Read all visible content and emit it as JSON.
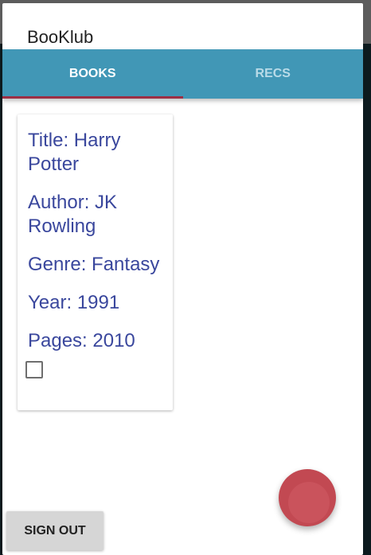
{
  "app": {
    "title": "BooKlub"
  },
  "tabs": [
    {
      "label": "BOOKS",
      "selected": true
    },
    {
      "label": "RECS",
      "selected": false
    }
  ],
  "colors": {
    "tab_bar": "#4197b6",
    "indicator": "#9c2f45",
    "fab": "#c24952",
    "text": "#3a479d"
  },
  "book": {
    "title": "Title: Harry Potter",
    "author": "Author: JK Rowling",
    "genre": "Genre: Fantasy",
    "year": "Year: 1991",
    "pages": "Pages: 2010",
    "checked": false
  },
  "fab": {
    "icon": "circle-icon"
  },
  "footer": {
    "sign_out_label": "SIGN OUT"
  }
}
